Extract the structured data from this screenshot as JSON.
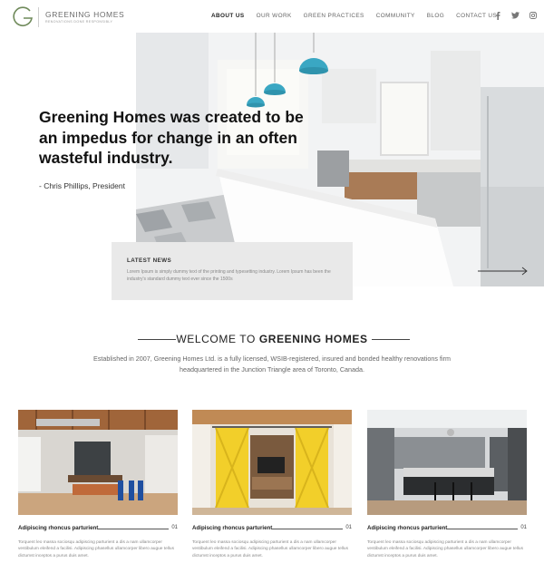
{
  "brand": {
    "name": "GREENING HOMES",
    "tagline": "RENOVATIONS DONE RESPONSIBLY"
  },
  "nav": {
    "items": [
      "ABOUT US",
      "OUR WORK",
      "GREEN PRACTICES",
      "COMMUNITY",
      "BLOG",
      "CONTACT US"
    ],
    "active": "ABOUT US"
  },
  "social": [
    "facebook-icon",
    "twitter-icon",
    "instagram-icon"
  ],
  "hero": {
    "quote": "Greening Homes was created to be an impedus for change in an often wasteful industry.",
    "author": "- Chris Phillips, President"
  },
  "news": {
    "title": "LATEST NEWS",
    "text": "Lorem Ipsum is simply dummy text of the printing and typesetting industry. Lorem Ipsum has been the industry's standard dummy text ever since the 1500s"
  },
  "welcome": {
    "title_prefix": "WELCOME TO",
    "title_strong": "GREENING HOMES",
    "text": "Established in 2007, Greening Homes Ltd. is a fully licensed, WSIB-registered, insured and bonded healthy renovations firm headquartered in the Junction Triangle area of Toronto, Canada."
  },
  "cards": [
    {
      "title": "Adipiscing rhoncus parturient",
      "number": "01",
      "text": "Torquent leo massa sociosqu adipiscing parturient a dis a nam ullamcorper vestibulum eleifend a facilisi. Adipiscing phasellus ullamcorper libero augue tellus dictumst inceptos a purus duis amet."
    },
    {
      "title": "Adipiscing rhoncus parturient",
      "number": "01",
      "text": "Torquent leo massa sociosqu adipiscing parturient a dis a nam ullamcorper vestibulum eleifend a facilisi. Adipiscing phasellus ullamcorper libero augue tellus dictumst inceptos a purus duis amet."
    },
    {
      "title": "Adipiscing rhoncus parturient",
      "number": "01",
      "text": "Torquent leo massa sociosqu adipiscing parturient a dis a nam ullamcorper vestibulum eleifend a facilisi. Adipiscing phasellus ullamcorper libero augue tellus dictumst inceptos a purus duis amet."
    }
  ],
  "colors": {
    "brand_green": "#6f8a5a",
    "pendant_blue": "#3aa7c3",
    "door_yellow": "#f2cf2a"
  }
}
